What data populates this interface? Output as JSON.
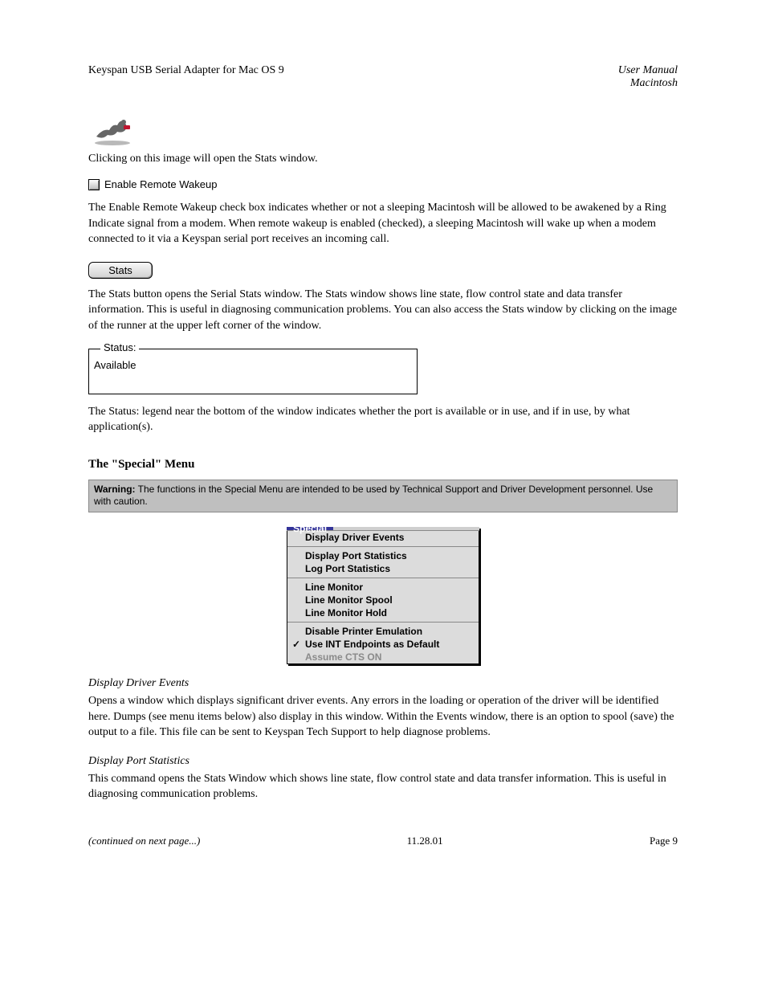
{
  "header": {
    "left": "Keyspan USB Serial Adapter for Mac OS 9",
    "right_line1": "User Manual",
    "right_line2": "Macintosh"
  },
  "clickable_label": "Clicking on this image will open the Stats window.",
  "checkbox": {
    "label": "Enable Remote Wakeup"
  },
  "remote_wakeup_para": "The Enable Remote Wakeup check box indicates whether or not a sleeping Macintosh will be allowed to be awakened by a Ring Indicate signal from a modem. When remote wakeup is enabled (checked), a sleeping Macintosh will wake up when a modem connected to it via a Keyspan serial port receives an incoming call.",
  "stats_button_label": "Stats",
  "stats_button_para": "The Stats button opens the Serial Stats window. The Stats window shows line state, flow control state and data transfer information. This is useful in diagnosing communication problems. You can also access the Stats window by clicking on the image of the runner at the upper left corner of the window.",
  "status_legend": "Status:",
  "status_value": "Available",
  "status_legend_para": "The Status: legend near the bottom of the window indicates whether the port is available or in use, and if in use, by what application(s).",
  "special_menu_heading": "The \"Special\" Menu",
  "banner_bold": "Warning:",
  "banner_text": " The functions in the Special Menu are intended to be used by Technical Support and Driver Development personnel. Use with caution.",
  "menu": {
    "title": "Special",
    "items": [
      {
        "label": "Display Driver Events",
        "type": "item"
      },
      {
        "type": "sep"
      },
      {
        "label": "Display Port Statistics",
        "type": "item"
      },
      {
        "label": "Log Port Statistics",
        "type": "item"
      },
      {
        "type": "sep"
      },
      {
        "label": "Line Monitor",
        "type": "item"
      },
      {
        "label": "Line Monitor Spool",
        "type": "item"
      },
      {
        "label": "Line Monitor Hold",
        "type": "item"
      },
      {
        "type": "sep"
      },
      {
        "label": "Disable Printer Emulation",
        "type": "item"
      },
      {
        "label": "Use INT Endpoints as Default",
        "type": "item",
        "checked": true
      },
      {
        "label": "Assume CTS ON",
        "type": "item",
        "disabled": true
      }
    ]
  },
  "driver_events_head": "Display Driver Events",
  "driver_events_para": "Opens a window which displays significant driver events. Any errors in the loading or operation of the driver will be identified here. Dumps (see menu items below) also display in this window. Within the Events window, there is an option to spool (save) the output to a file. This file can be sent to Keyspan Tech Support to help diagnose problems.",
  "port_stats_head": "Display Port Statistics",
  "port_stats_para": "This command opens the Stats Window which shows line state, flow control state and data transfer information. This is useful in diagnosing communication problems.",
  "footer": {
    "left": "(continued on next page...)",
    "center": "11.28.01",
    "right": "Page 9"
  }
}
